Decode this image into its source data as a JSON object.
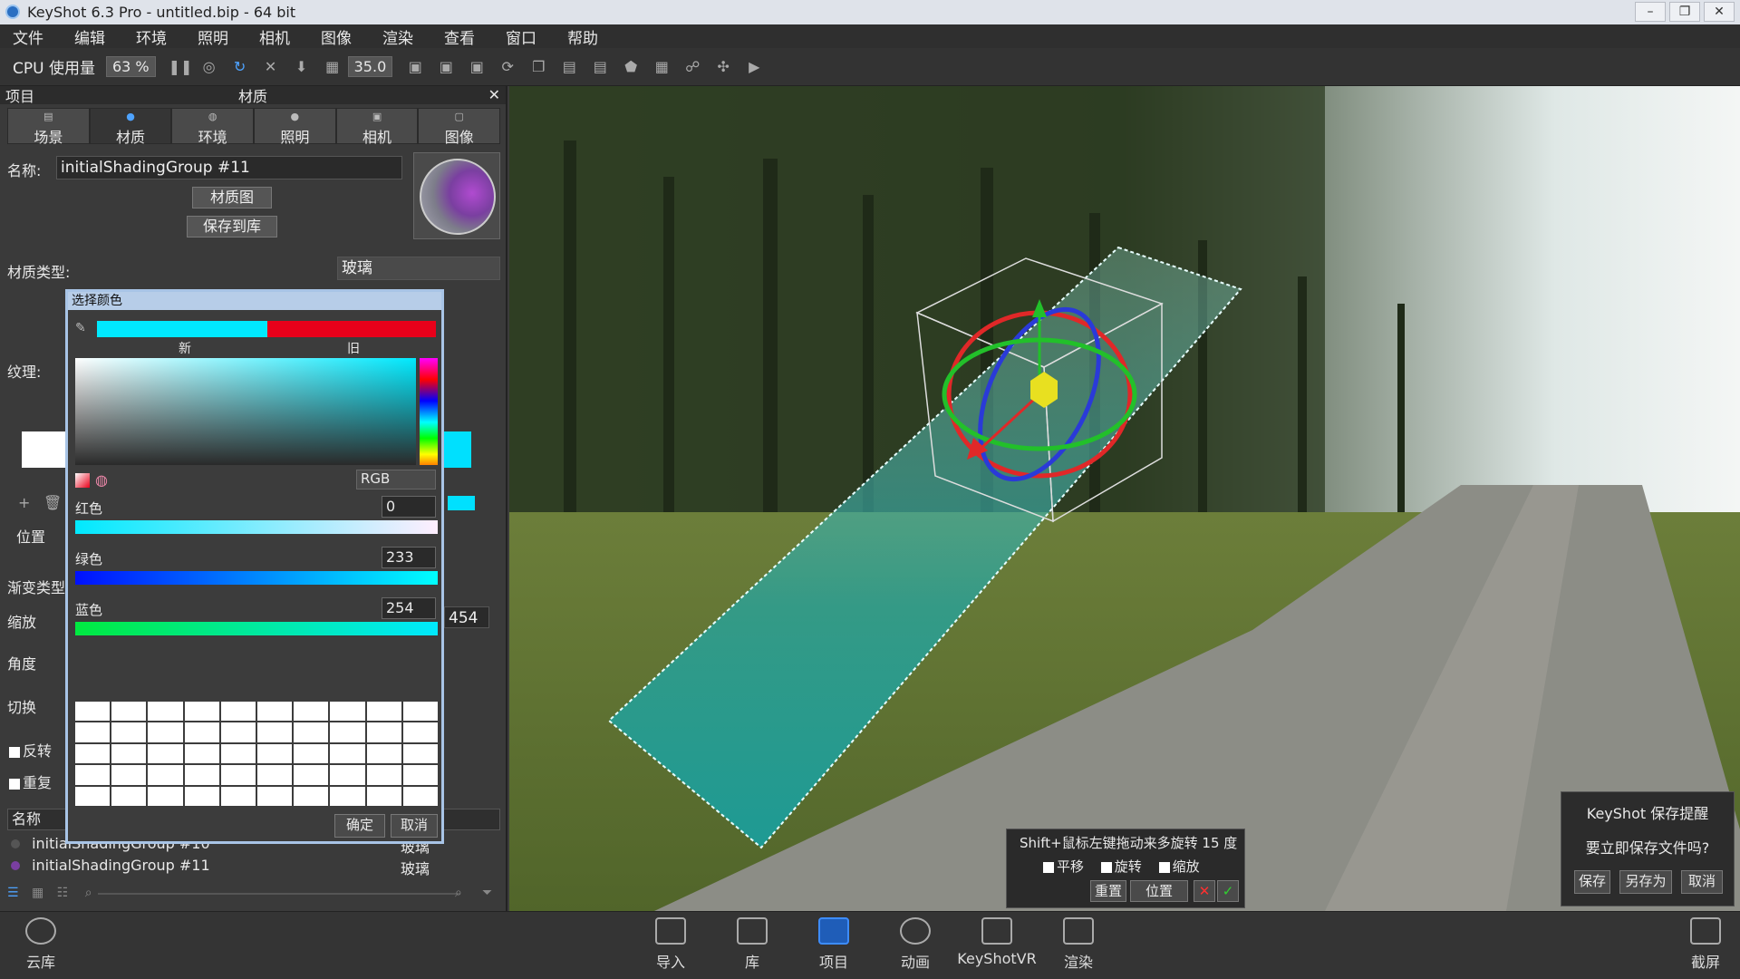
{
  "window": {
    "title": "KeyShot 6.3 Pro  - untitled.bip  - 64 bit",
    "min": "–",
    "max": "❐",
    "close": "✕"
  },
  "menu": [
    "文件",
    "编辑",
    "环境",
    "照明",
    "相机",
    "图像",
    "渲染",
    "查看",
    "窗口",
    "帮助"
  ],
  "toolbar": {
    "cpu_label": "CPU 使用量",
    "cpu_value": "63 %",
    "fov_value": "35.0"
  },
  "panel": {
    "header_left": "项目",
    "header_center": "材质",
    "tabs": [
      {
        "label": "场景"
      },
      {
        "label": "材质"
      },
      {
        "label": "环境"
      },
      {
        "label": "照明"
      },
      {
        "label": "相机"
      },
      {
        "label": "图像"
      }
    ],
    "active_tab": "材质",
    "name_label": "名称:",
    "name_value": "initialShadingGroup #11",
    "material_graph_btn": "材质图",
    "save_lib_btn": "保存到库",
    "material_type_label": "材质类型:",
    "material_type_value": "玻璃",
    "texture_label": "纹理:",
    "position_label": "位置",
    "gradient_type_label": "渐变类型",
    "scale_label": "缩放",
    "scale_value": "454",
    "angle_label": "角度",
    "switch_label": "切换",
    "reverse_label": "反转",
    "repeat_label": "重复",
    "list_header": "名称",
    "list": [
      {
        "name": "initialShadingGroup #10",
        "type": "玻璃"
      },
      {
        "name": "initialShadingGroup #11",
        "type": "玻璃"
      }
    ]
  },
  "color_dialog": {
    "title": "选择颜色",
    "new_label": "新",
    "old_label": "旧",
    "mode": "RGB",
    "red_label": "红色",
    "red_value": "0",
    "green_label": "绿色",
    "green_value": "233",
    "blue_label": "蓝色",
    "blue_value": "254",
    "ok": "确定",
    "cancel": "取消",
    "new_color": "#00e9fe",
    "old_color": "#e8001a"
  },
  "rotate_hint": {
    "text": "Shift+鼠标左键拖动来多旋转 15 度",
    "pan": "平移",
    "rotate": "旋转",
    "scale": "缩放",
    "reset": "重置",
    "position": "位置"
  },
  "save_reminder": {
    "title": "KeyShot 保存提醒",
    "question": "要立即保存文件吗?",
    "save": "保存",
    "save_as": "另存为",
    "cancel": "取消"
  },
  "dock": {
    "cloud": "云库",
    "import": "导入",
    "library": "库",
    "project": "项目",
    "animation": "动画",
    "vr": "KeyShotVR",
    "render": "渲染",
    "screenshot": "截屏"
  }
}
